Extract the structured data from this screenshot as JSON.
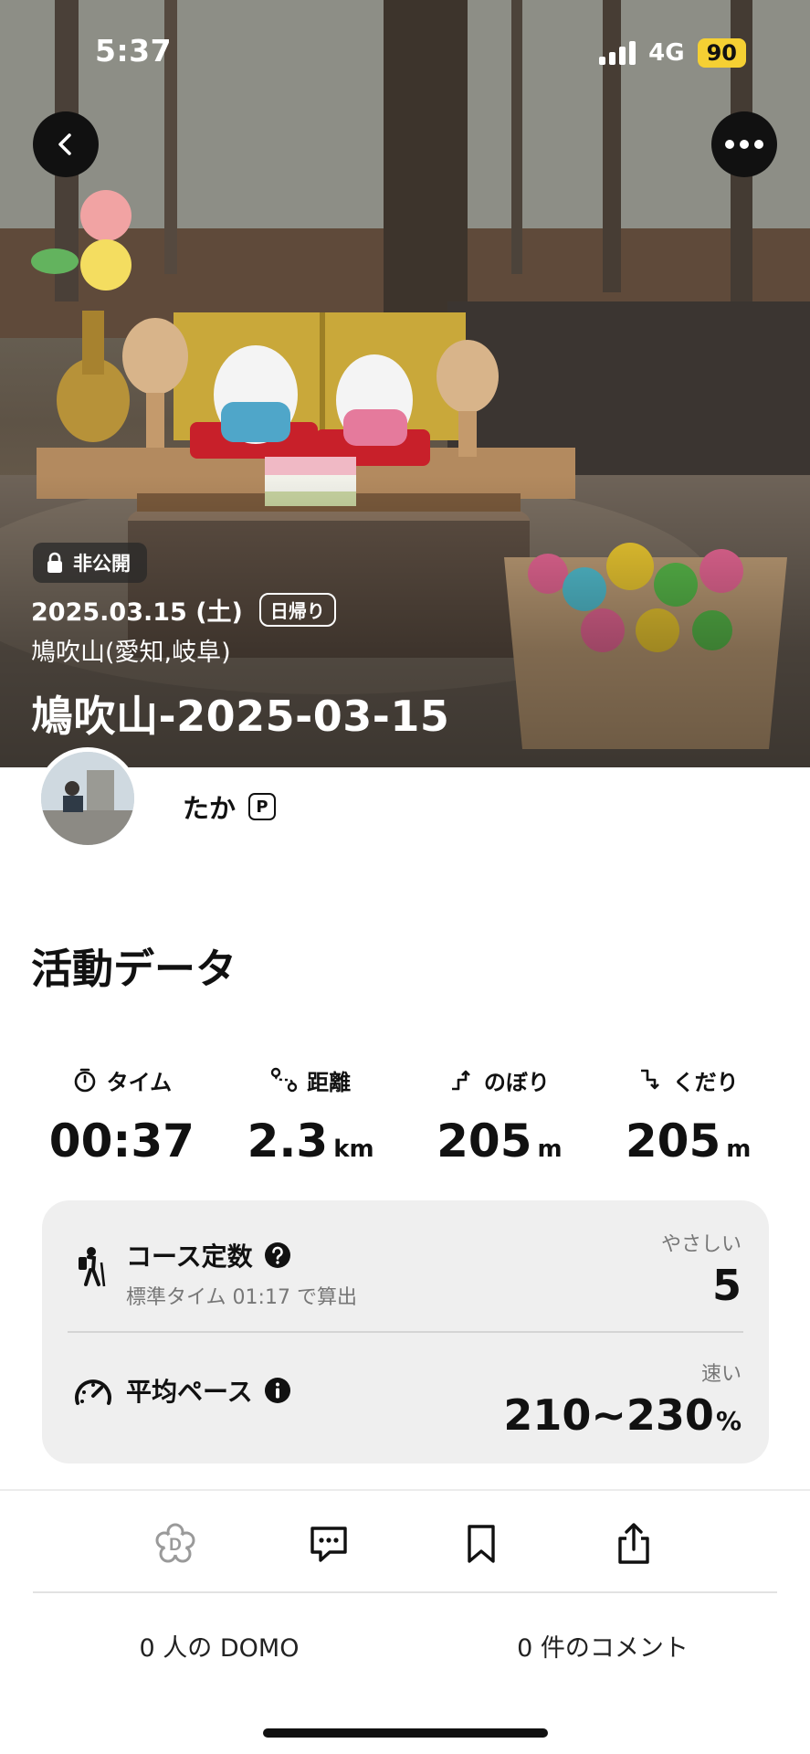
{
  "status_bar": {
    "time": "5:37",
    "network": "4G",
    "battery": "90"
  },
  "header": {
    "privacy_label": "非公開",
    "date": "2025.03.15 (土)",
    "activity_type": "日帰り",
    "location": "鳩吹山(愛知,岐阜)",
    "title": "鳩吹山-2025-03-15"
  },
  "user": {
    "name": "たか",
    "badge": "P"
  },
  "activity": {
    "section_title": "活動データ",
    "stats": [
      {
        "label": "タイム",
        "value": "00:37",
        "unit": "",
        "icon": "stopwatch-icon"
      },
      {
        "label": "距離",
        "value": "2.3",
        "unit": "km",
        "icon": "route-icon"
      },
      {
        "label": "のぼり",
        "value": "205",
        "unit": "m",
        "icon": "ascent-icon"
      },
      {
        "label": "くだり",
        "value": "205",
        "unit": "m",
        "icon": "descent-icon"
      }
    ]
  },
  "course": {
    "title": "コース定数",
    "subtitle": "標準タイム 01:17 で算出",
    "difficulty": "やさしい",
    "value": "5"
  },
  "pace": {
    "title": "平均ペース",
    "rating": "速い",
    "value": "210~230",
    "unit": "%"
  },
  "actions": {
    "domo_count": "0 人の DOMO",
    "comment_count": "0 件のコメント"
  }
}
